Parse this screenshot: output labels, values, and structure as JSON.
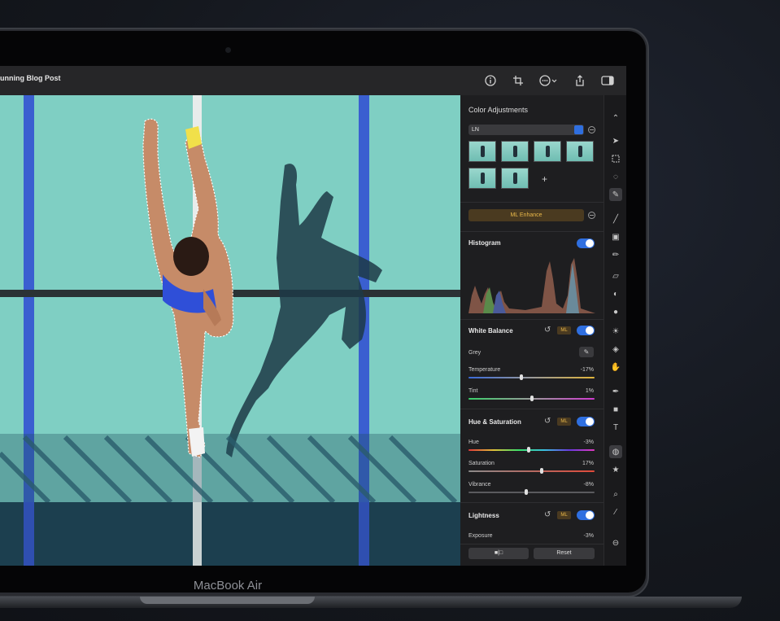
{
  "window": {
    "title": "unning Blog Post"
  },
  "device": {
    "brand": "MacBook Air"
  },
  "titlebar_icons": [
    "info-icon",
    "crop-icon",
    "more-options-icon",
    "share-icon",
    "sidebar-icon"
  ],
  "panel": {
    "title": "Color Adjustments",
    "preset_select": "LN",
    "add_preset": "+",
    "ml_enhance": "ML Enhance",
    "histogram": {
      "title": "Histogram",
      "enabled": true
    },
    "white_balance": {
      "title": "White Balance",
      "ml_badge": "ML",
      "enabled": true,
      "grey_label": "Grey",
      "temperature": {
        "label": "Temperature",
        "value": "-17%",
        "level": 0.42
      },
      "tint": {
        "label": "Tint",
        "value": "1%",
        "level": 0.5
      }
    },
    "hue_saturation": {
      "title": "Hue & Saturation",
      "ml_badge": "ML",
      "enabled": true,
      "hue": {
        "label": "Hue",
        "value": "-3%",
        "level": 0.48
      },
      "saturation": {
        "label": "Saturation",
        "value": "17%",
        "level": 0.58
      },
      "vibrance": {
        "label": "Vibrance",
        "value": "-8%",
        "level": 0.46
      }
    },
    "lightness": {
      "title": "Lightness",
      "ml_badge": "ML",
      "enabled": true,
      "exposure": {
        "label": "Exposure",
        "value": "-3%"
      }
    },
    "compare_button": "■|□",
    "reset_button": "Reset"
  },
  "colors": {
    "accent": "#2f6fe0",
    "ml_gold": "#e9b84a",
    "track_blue": "#3a5fd0",
    "court": "#7fcfc3"
  },
  "tools": [
    "arrange-icon",
    "pointer-icon",
    "rect-select-icon",
    "lasso-icon",
    "quick-select-icon",
    "brush-icon",
    "paint-bucket-icon",
    "pencil-icon",
    "eraser-icon",
    "color-adjust-icon",
    "blur-icon",
    "light-icon",
    "smudge-icon",
    "hand-icon",
    "pen-icon",
    "shape-icon",
    "text-icon",
    "retouch-icon",
    "star-icon",
    "zoom-icon",
    "eyedropper-icon",
    "more-icon"
  ]
}
